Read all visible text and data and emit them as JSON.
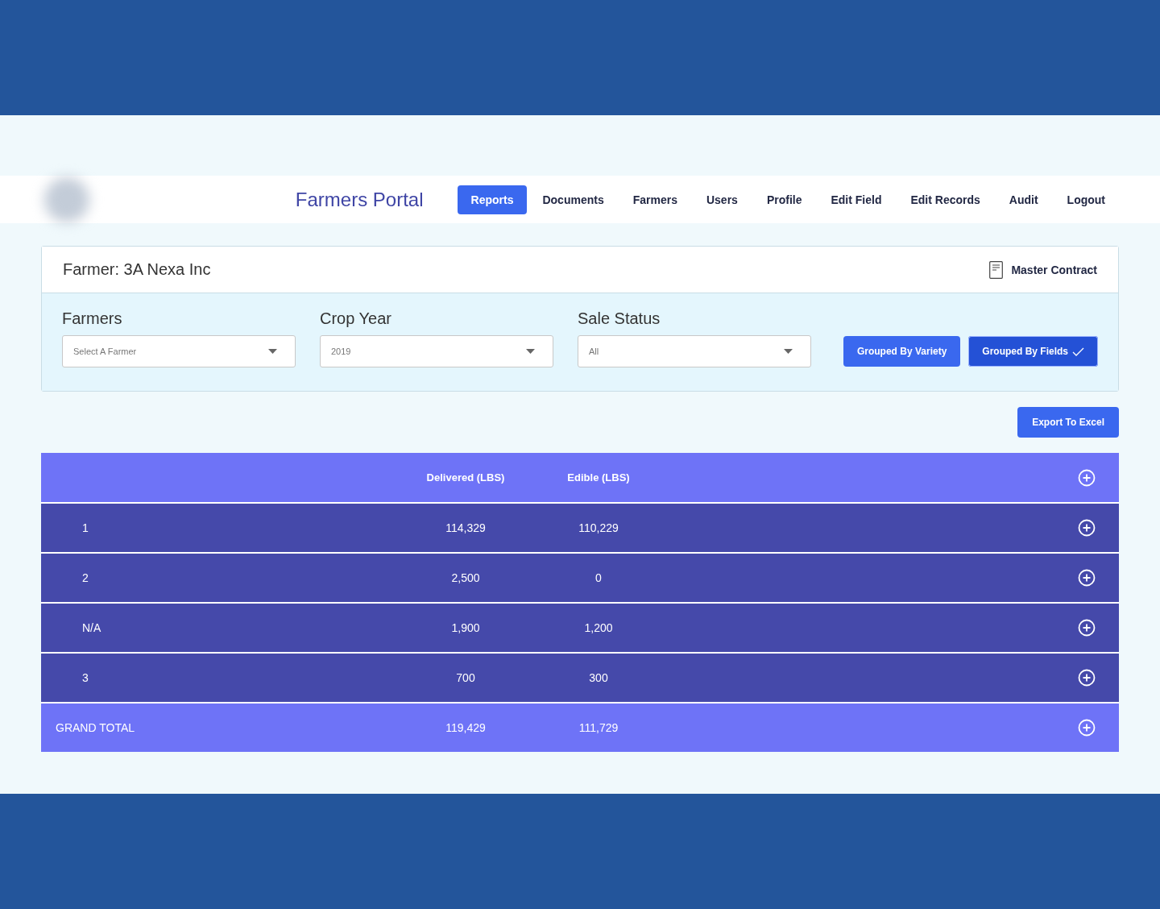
{
  "nav": {
    "title": "Farmers Portal",
    "items": [
      {
        "label": "Reports",
        "selected": true
      },
      {
        "label": "Documents",
        "selected": false
      },
      {
        "label": "Farmers",
        "selected": false
      },
      {
        "label": "Users",
        "selected": false
      },
      {
        "label": "Profile",
        "selected": false
      },
      {
        "label": "Edit Field",
        "selected": false
      },
      {
        "label": "Edit Records",
        "selected": false
      },
      {
        "label": "Audit",
        "selected": false
      },
      {
        "label": "Logout",
        "selected": false
      }
    ]
  },
  "card": {
    "farmer_label": "Farmer:",
    "farmer_name": "3A Nexa Inc",
    "contract_link": "Master Contract",
    "filters": [
      {
        "label": "Farmers",
        "value": "Select A Farmer"
      },
      {
        "label": "Crop Year",
        "value": "2019"
      },
      {
        "label": "Sale Status",
        "value": "All"
      }
    ],
    "grouping": [
      {
        "label": "Grouped By Variety",
        "selected": false
      },
      {
        "label": "Grouped By Fields",
        "selected": true
      }
    ]
  },
  "export_button": "Export To Excel",
  "table": {
    "columns": [
      "Delivered (LBS)",
      "Edible (LBS)"
    ],
    "rows": [
      {
        "kind": "group",
        "label": "1",
        "delivered": "114,329",
        "edible": "110,229"
      },
      {
        "kind": "group",
        "label": "2",
        "delivered": "2,500",
        "edible": "0"
      },
      {
        "kind": "group",
        "label": "N/A",
        "delivered": "1,900",
        "edible": "1,200"
      },
      {
        "kind": "group",
        "label": "3",
        "delivered": "700",
        "edible": "300"
      },
      {
        "kind": "total",
        "label": "GRAND TOTAL",
        "delivered": "119,429",
        "edible": "111,729"
      }
    ]
  }
}
